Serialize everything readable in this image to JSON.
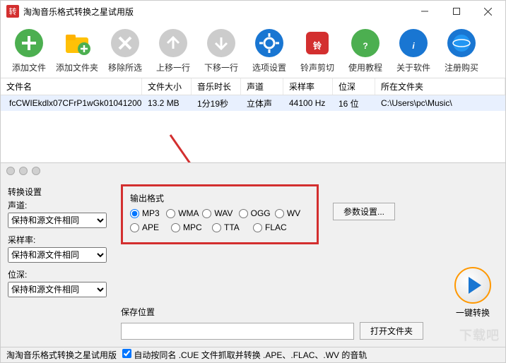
{
  "window": {
    "icon_text": "转",
    "title": "淘淘音乐格式转换之星试用版"
  },
  "toolbar": [
    {
      "label": "添加文件",
      "icon": "add-file"
    },
    {
      "label": "添加文件夹",
      "icon": "add-folder"
    },
    {
      "label": "移除所选",
      "icon": "remove"
    },
    {
      "label": "上移一行",
      "icon": "move-up"
    },
    {
      "label": "下移一行",
      "icon": "move-down"
    },
    {
      "label": "选项设置",
      "icon": "settings"
    },
    {
      "label": "铃声剪切",
      "icon": "ringtone"
    },
    {
      "label": "使用教程",
      "icon": "help"
    },
    {
      "label": "关于软件",
      "icon": "about"
    },
    {
      "label": "注册购买",
      "icon": "register"
    }
  ],
  "columns": {
    "filename": "文件名",
    "filesize": "文件大小",
    "duration": "音乐时长",
    "channel": "声道",
    "samplerate": "采样率",
    "bitdepth": "位深",
    "folder": "所在文件夹"
  },
  "rows": [
    {
      "filename": "fcCWIEkdlx07CFrP1wGk01041200...",
      "filesize": "13.2 MB",
      "duration": "1分19秒",
      "channel": "立体声",
      "samplerate": "44100 Hz",
      "bitdepth": "16 位",
      "folder": "C:\\Users\\pc\\Music\\"
    }
  ],
  "settings": {
    "title": "转换设置",
    "channel_label": "声道:",
    "channel_value": "保持和源文件相同",
    "samplerate_label": "采样率:",
    "samplerate_value": "保持和源文件相同",
    "bitdepth_label": "位深:",
    "bitdepth_value": "保持和源文件相同"
  },
  "output": {
    "title": "输出格式",
    "formats_row1": [
      "MP3",
      "WMA",
      "WAV",
      "OGG",
      "WV"
    ],
    "formats_row2": [
      "APE",
      "MPC",
      "TTA",
      "FLAC"
    ],
    "selected": "MP3",
    "param_btn": "参数设置...",
    "save_label": "保存位置",
    "save_path": "",
    "open_folder_btn": "打开文件夹"
  },
  "convert": {
    "label": "一键转换"
  },
  "status": {
    "app": "淘淘音乐格式转换之星试用版",
    "checkbox": "自动按同名 .CUE 文件抓取并转换 .APE、.FLAC、.WV 的音轨"
  },
  "watermark": "下载吧"
}
